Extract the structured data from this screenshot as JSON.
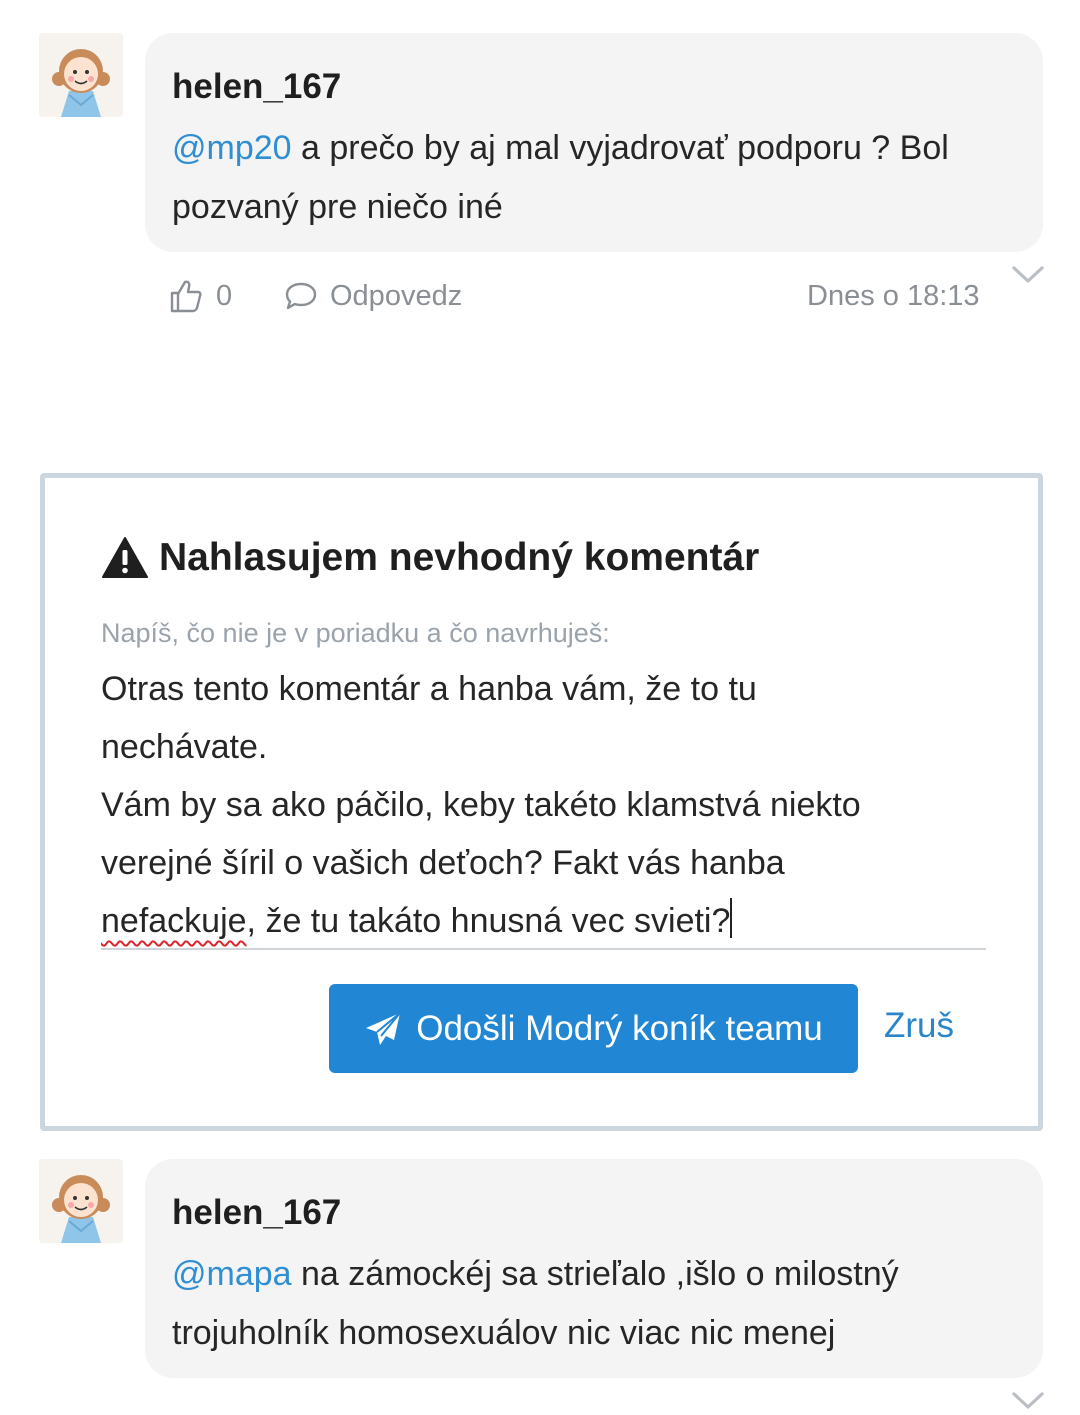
{
  "comments": [
    {
      "username": "helen_167",
      "mention": "@mp20",
      "text_line1": " a prečo by aj mal vyjadrovať podporu ? Bol",
      "text_line2": "pozvaný pre niečo iné",
      "likes": "0",
      "reply_label": "Odpovedz",
      "timestamp": "Dnes o 18:13"
    },
    {
      "username": "helen_167",
      "mention": "@mapa",
      "text_line1": " na zámockéj sa strieľalo ,išlo o milostný",
      "text_line2": "trojuholník homosexuálov nic viac nic menej"
    }
  ],
  "report": {
    "title": "Nahlasujem nevhodný komentár",
    "label": "Napíš, čo nie je v poriadku a čo navrhuješ:",
    "text_line1": "Otras tento komentár a hanba vám, že to tu",
    "text_line2": "nechávate.",
    "text_line3": "Vám by sa ako páčilo, keby takéto klamstvá niekto",
    "text_line4": "verejné šíril o vašich deťoch? Fakt vás hanba",
    "text_line5_misspelled": "nefackuje",
    "text_line5_rest": ", že tu takáto hnusná vec svieti?",
    "send_label": "Odošli Modrý koník teamu",
    "cancel_label": "Zruš"
  },
  "icons": [
    "avatar-girl",
    "thumbs-up-icon",
    "chat-bubble-icon",
    "chevron-down-icon",
    "warning-icon",
    "paper-plane-icon"
  ],
  "colors": {
    "accent": "#2187d4",
    "mention": "#2f8fd2",
    "bubble": "#f4f4f5",
    "border": "#ccd6de",
    "muted": "#8a8f95"
  }
}
